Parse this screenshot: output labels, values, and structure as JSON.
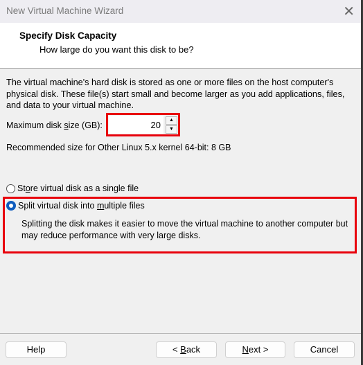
{
  "window": {
    "title": "New Virtual Machine Wizard",
    "close_icon": "close-icon"
  },
  "header": {
    "title": "Specify Disk Capacity",
    "subtitle": "How large do you want this disk to be?"
  },
  "body": {
    "description": "The virtual machine's hard disk is stored as one or more files on the host computer's physical disk. These file(s) start small and become larger as you add applications, files, and data to your virtual machine.",
    "size_label": {
      "pre": "Maximum disk ",
      "mnemonic": "s",
      "post": "ize (GB):"
    },
    "size_value": "20",
    "recommended": "Recommended size for Other Linux 5.x kernel 64-bit: 8 GB",
    "options": [
      {
        "pre": "St",
        "mnemonic": "o",
        "post": "re virtual disk as a single file",
        "selected": false
      },
      {
        "pre": "Split virtual disk into ",
        "mnemonic": "m",
        "post": "ultiple files",
        "selected": true
      }
    ],
    "split_description": "Splitting the disk makes it easier to move the virtual machine to another computer but may reduce performance with very large disks.",
    "highlight_color": "#e8000b",
    "accent_color": "#0f5cbe"
  },
  "footer": {
    "help": "Help",
    "back": {
      "pre": "< ",
      "mnemonic": "B",
      "post": "ack"
    },
    "next": {
      "pre": "",
      "mnemonic": "N",
      "post": "ext >"
    },
    "cancel": "Cancel"
  }
}
